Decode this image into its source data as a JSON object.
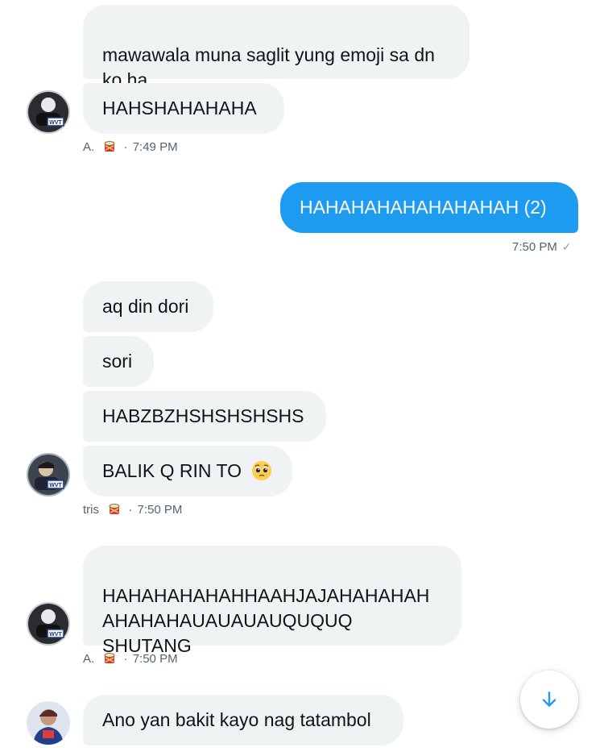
{
  "messages": [
    {
      "text": "mawawala muna saglit yung emoji sa dn\nko ha"
    },
    {
      "text": "HAHSHAHAHAHA"
    },
    {
      "text": "HAHAHAHAHAHAHAHAH (2)"
    },
    {
      "text": "aq din dori"
    },
    {
      "text": "sori"
    },
    {
      "text": "HABZBZHSHSHSHSHS"
    },
    {
      "text": "BALIK Q RIN TO"
    },
    {
      "text": "HAHAHAHAHAHHAAHJAJAHAHAHAH\nAHAHAHAUAUAUAUQUQUQ\nSHUTANG"
    },
    {
      "text": "Ano yan bakit kayo nag tatambol"
    }
  ],
  "meta": {
    "group1": {
      "sender": "A.",
      "time": "7:49 PM"
    },
    "outgoing": {
      "time": "7:50 PM",
      "check": "✓"
    },
    "group2": {
      "sender": "tris",
      "time": "7:50 PM"
    },
    "group3": {
      "sender": "A.",
      "time": "7:50 PM"
    }
  },
  "separator": "·",
  "icons": {
    "drum": "drum-emoji",
    "pleading": "pleading-face-emoji",
    "scroll_down": "arrow-down-icon"
  },
  "colors": {
    "incoming_bubble": "#eff3f4",
    "outgoing_bubble": "#1d9bf0",
    "meta_text": "#536471",
    "accent": "#1d9bf0"
  }
}
